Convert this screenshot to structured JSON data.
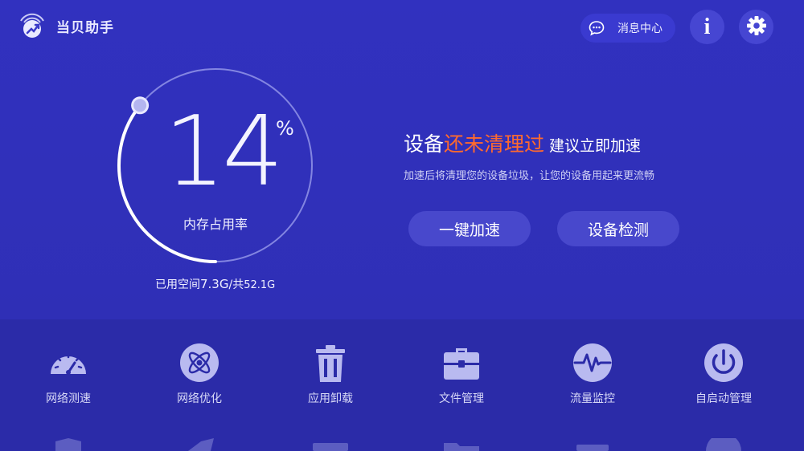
{
  "app": {
    "name": "当贝助手"
  },
  "header": {
    "message_center_label": "消息中心",
    "info_label": "i"
  },
  "gauge": {
    "percent": "14",
    "percent_sign": "%",
    "percent_value": 14,
    "label": "内存占用率",
    "storage_prefix": "已用空间",
    "storage_used": "7.3G",
    "storage_sep": "/共",
    "storage_total": "52.1G"
  },
  "status": {
    "headline_start": "设备",
    "headline_highlight": "还未清理过",
    "headline_end": "建议立即加速",
    "subline": "加速后将清理您的设备垃圾，让您的设备用起来更流畅",
    "highlight_color": "#ff6a2e"
  },
  "actions": {
    "boost_label": "一键加速",
    "check_label": "设备检测"
  },
  "tools": [
    {
      "label": "网络测速",
      "icon": "speedometer-icon"
    },
    {
      "label": "网络优化",
      "icon": "atom-icon"
    },
    {
      "label": "应用卸载",
      "icon": "trash-icon"
    },
    {
      "label": "文件管理",
      "icon": "toolbox-icon"
    },
    {
      "label": "流量监控",
      "icon": "pulse-icon"
    },
    {
      "label": "自启动管理",
      "icon": "power-icon"
    }
  ],
  "colors": {
    "background": "#2f2fb4",
    "bottom_panel": "#2b2ba8",
    "button": "#4848cc",
    "icon_fill": "#b9baf0"
  }
}
